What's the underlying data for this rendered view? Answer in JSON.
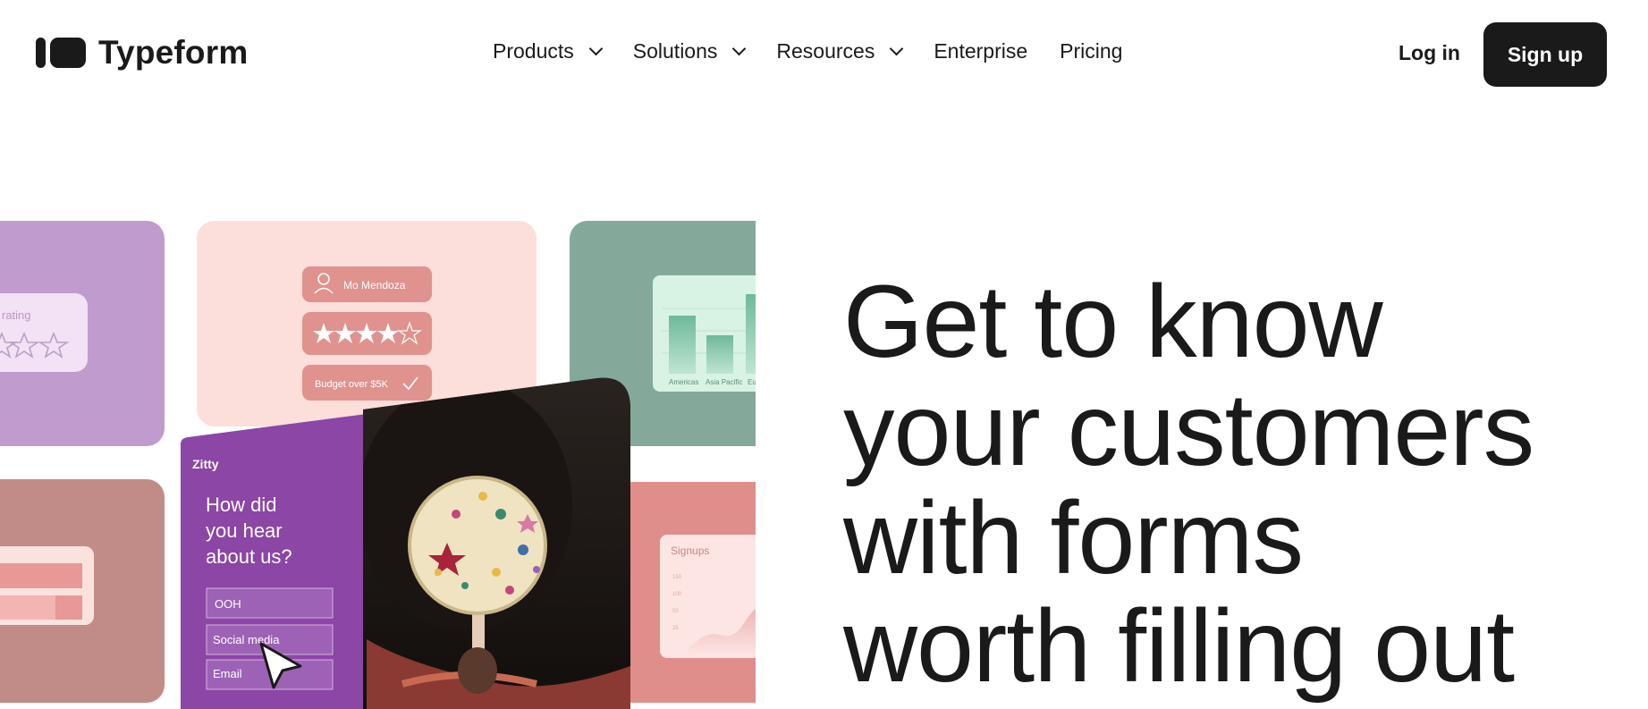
{
  "brand": {
    "name": "Typeform"
  },
  "nav": {
    "items": [
      {
        "label": "Products",
        "dropdown": true
      },
      {
        "label": "Solutions",
        "dropdown": true
      },
      {
        "label": "Resources",
        "dropdown": true
      },
      {
        "label": "Enterprise",
        "dropdown": false
      },
      {
        "label": "Pricing",
        "dropdown": false
      }
    ],
    "login_label": "Log in",
    "signup_label": "Sign up"
  },
  "hero": {
    "title_lines": [
      "Get to know",
      "your customers",
      "with forms",
      "worth filling out"
    ]
  },
  "collage": {
    "rating_card": {
      "label": "rating"
    },
    "profile_card": {
      "name": "Mo Mendoza",
      "stars_filled": 4,
      "stars_total": 5,
      "budget": "Budget over $5K"
    },
    "bar_chart_card": {
      "labels": [
        "Americas",
        "Asia Pacific",
        "Euro"
      ]
    },
    "survey_card": {
      "brand": "Zitty",
      "question": "How did you hear about us?",
      "question_lines": [
        "How did",
        "you hear",
        "about us?"
      ],
      "options": [
        "OOH",
        "Social media",
        "Email"
      ]
    },
    "signups_card": {
      "title": "Signups",
      "ticks": [
        "150",
        "100",
        "50",
        "25"
      ]
    }
  },
  "colors": {
    "text": "#1a1a1a",
    "button_bg": "#1a1a1a",
    "button_text": "#ffffff",
    "lilac": "#c09bcd",
    "pink": "#fcdedb",
    "sage": "#84a99a",
    "mauve": "#c18c88",
    "purple": "#8b46a6",
    "salmon": "#e08e8b"
  }
}
